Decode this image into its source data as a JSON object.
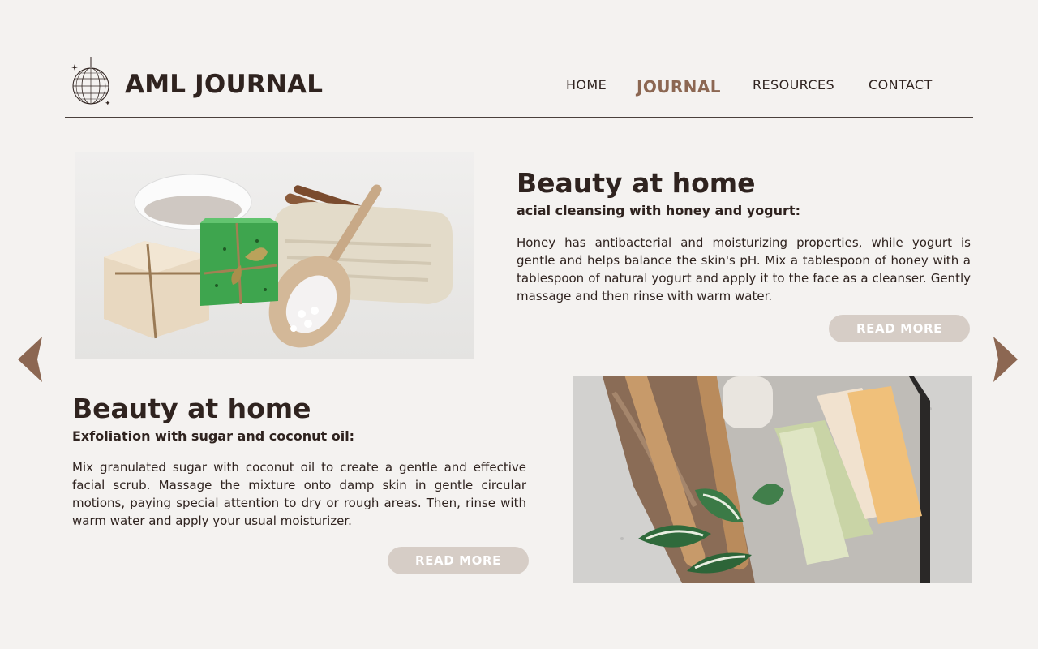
{
  "header": {
    "site_title": "AML JOURNAL",
    "nav": [
      {
        "label": "HOME"
      },
      {
        "label": "JOURNAL",
        "active": true
      },
      {
        "label": "RESOURCES"
      },
      {
        "label": "CONTACT"
      }
    ]
  },
  "articles": [
    {
      "title": "Beauty at home",
      "subtitle": "acial cleansing with honey and yogurt:",
      "body": "Honey has antibacterial and moisturizing properties, while yogurt is gentle and helps balance the skin's pH. Mix a tablespoon of honey with a tablespoon of natural yogurt and apply it to the face as a cleanser. Gently massage and then rinse with warm water.",
      "button_label": "READ MORE"
    },
    {
      "title": "Beauty at home",
      "subtitle": "Exfoliation with sugar and coconut oil:",
      "body": "Mix granulated sugar with coconut oil to create a gentle and effective facial scrub. Massage the mixture onto damp skin in gentle circular motions, paying special attention to dry or rough areas. Then, rinse with warm water and apply your usual moisturizer.",
      "button_label": "READ MORE"
    }
  ],
  "icons": {
    "logo": "disco-ball-icon",
    "prev": "arrow-left-icon",
    "next": "arrow-right-icon"
  },
  "colors": {
    "background": "#f4f2f0",
    "text": "#2f231f",
    "accent": "#8c6752",
    "button": "#d6cdc6"
  }
}
